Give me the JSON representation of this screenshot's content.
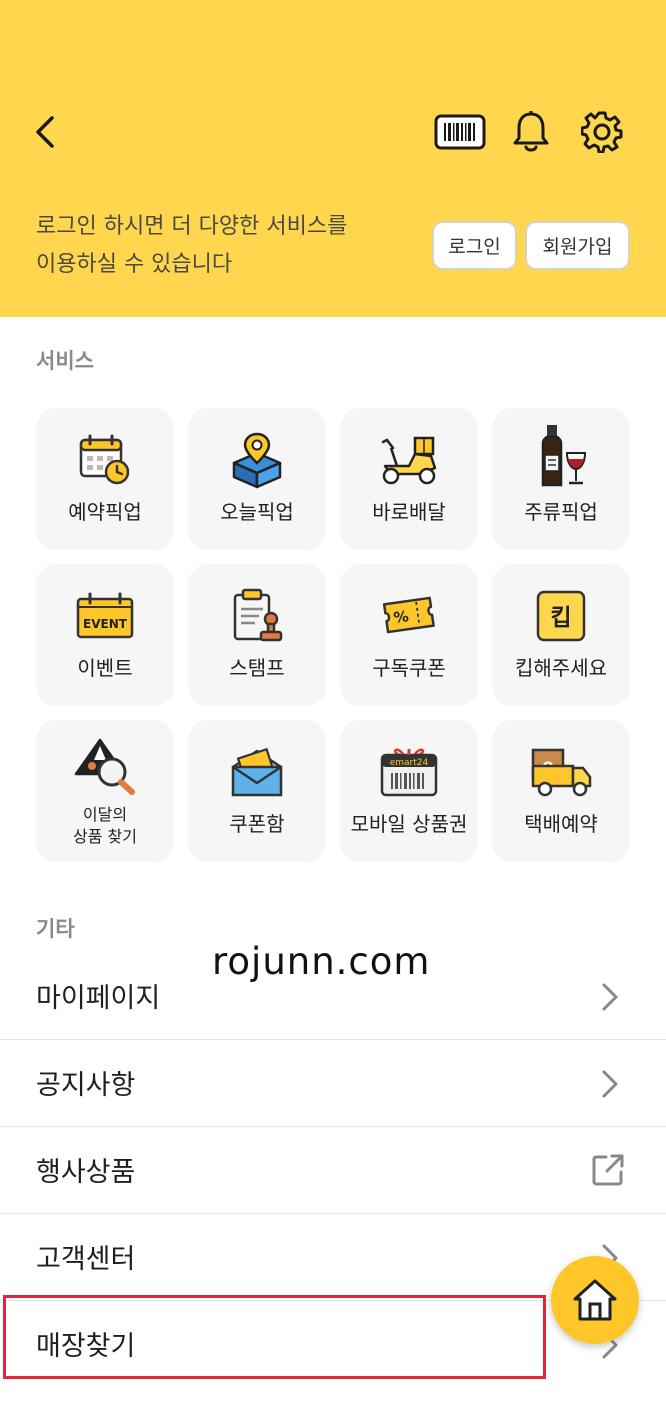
{
  "header": {
    "icons": [
      "chevron-left-icon",
      "barcode-icon",
      "bell-icon",
      "gear-icon"
    ],
    "login_message_line1": "로그인 하시면 더 다양한 서비스를",
    "login_message_line2": "이용하실 수 있습니다",
    "login_label": "로그인",
    "signup_label": "회원가입",
    "bg_color": "#ffd64d"
  },
  "services": {
    "title": "서비스",
    "items": [
      {
        "label": "예약픽업",
        "icon": "calendar-clock-icon"
      },
      {
        "label": "오늘픽업",
        "icon": "box-location-icon"
      },
      {
        "label": "바로배달",
        "icon": "scooter-icon"
      },
      {
        "label": "주류픽업",
        "icon": "liquor-icon"
      },
      {
        "label": "이벤트",
        "icon": "event-calendar-icon"
      },
      {
        "label": "스탬프",
        "icon": "stamp-icon"
      },
      {
        "label": "구독쿠폰",
        "icon": "coupon-ticket-icon"
      },
      {
        "label": "킵해주세요",
        "icon": "keep-icon"
      },
      {
        "label_line1": "이달의",
        "label_line2": "상품 찾기",
        "icon": "search-product-icon"
      },
      {
        "label": "쿠폰함",
        "icon": "coupon-envelope-icon"
      },
      {
        "label": "모바일 상품권",
        "icon": "gift-card-icon",
        "brand_text": "emart24"
      },
      {
        "label": "택배예약",
        "icon": "delivery-truck-icon",
        "truck_letter": "e"
      }
    ]
  },
  "etc": {
    "title": "기타",
    "rows": [
      {
        "label": "마이페이지",
        "icon": "chevron-right-icon"
      },
      {
        "label": "공지사항",
        "icon": "chevron-right-icon"
      },
      {
        "label": "행사상품",
        "icon": "external-link-icon"
      },
      {
        "label": "고객센터",
        "icon": "chevron-right-icon"
      },
      {
        "label": "매장찾기",
        "icon": "chevron-right-icon"
      }
    ]
  },
  "watermark": "rojunn.com",
  "fab": {
    "icon": "home-icon"
  },
  "colors": {
    "accent": "#ffc629",
    "highlight": "#e3243b"
  }
}
